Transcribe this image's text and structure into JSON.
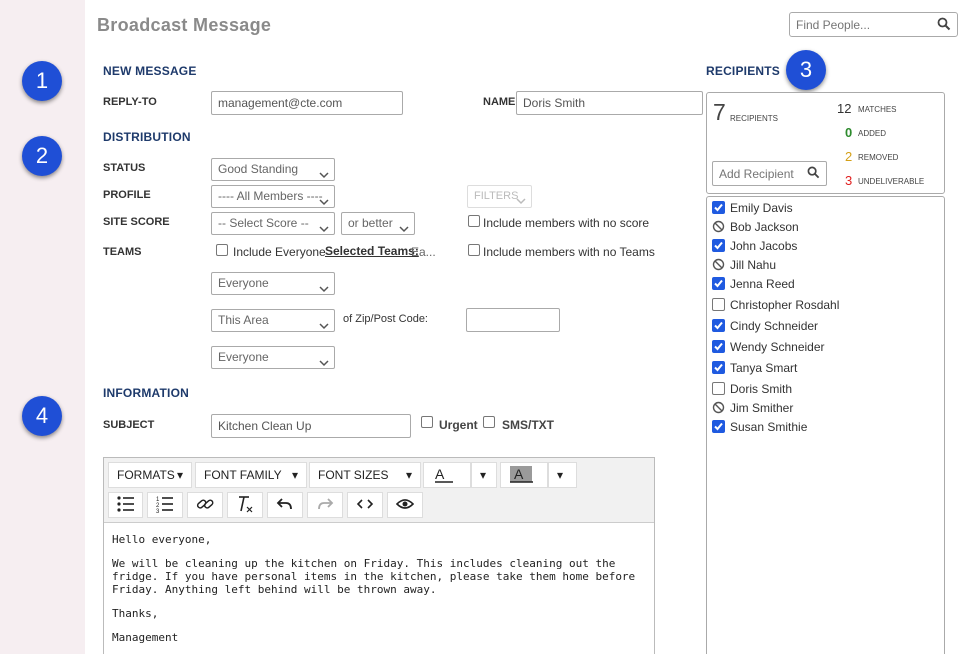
{
  "header": {
    "title": "Broadcast Message",
    "search_placeholder": "Find People..."
  },
  "badges": [
    "1",
    "2",
    "3",
    "4"
  ],
  "new_message": {
    "section": "NEW MESSAGE",
    "reply_to_label": "REPLY-TO",
    "reply_to_value": "management@cte.com",
    "name_label": "NAME",
    "name_value": "Doris Smith"
  },
  "distribution": {
    "section": "DISTRIBUTION",
    "status_label": "STATUS",
    "status_value": "Good Standing",
    "profile_label": "PROFILE",
    "profile_value": "---- All Members ----",
    "filters_label": "FILTERS",
    "site_score_label": "SITE SCORE",
    "site_score_value": "-- Select Score --",
    "or_better_value": "or better",
    "no_score_label": "Include members with no score",
    "teams_label": "TEAMS",
    "include_everyone_label": "Include Everyone",
    "selected_teams_label": "Selected Teams:",
    "selected_teams_value": "Ea...",
    "no_teams_label": "Include members with no Teams",
    "everyone_1": "Everyone",
    "this_area": "This Area",
    "zip_label": "of Zip/Post Code:",
    "zip_value": "",
    "everyone_2": "Everyone"
  },
  "information": {
    "section": "INFORMATION",
    "subject_label": "SUBJECT",
    "subject_value": "Kitchen Clean Up",
    "urgent_label": "Urgent",
    "sms_label": "SMS/TXT"
  },
  "editor": {
    "toolbar": {
      "formats": "FORMATS",
      "font_family": "FONT FAMILY",
      "font_sizes": "FONT SIZES"
    },
    "body": {
      "greeting": "Hello everyone,",
      "paragraph": "We will be cleaning up the kitchen on Friday. This includes cleaning out the fridge. If you have personal items in the kitchen, please take them home before Friday. Anything left behind will be thrown away.",
      "closing": "Thanks,",
      "signature": "Management"
    }
  },
  "recipients": {
    "section": "RECIPIENTS",
    "count": "7",
    "count_label": "RECIPIENTS",
    "add_placeholder": "Add Recipient",
    "stats": [
      {
        "value": "12",
        "label": "MATCHES",
        "color": "#333333"
      },
      {
        "value": "0",
        "label": "ADDED",
        "color": "#2e8b2e"
      },
      {
        "value": "2",
        "label": "REMOVED",
        "color": "#d4a017"
      },
      {
        "value": "3",
        "label": "UNDELIVERABLE",
        "color": "#e02020"
      }
    ],
    "list": [
      {
        "name": "Emily Davis",
        "state": "checked"
      },
      {
        "name": "Bob Jackson",
        "state": "blocked"
      },
      {
        "name": "John Jacobs",
        "state": "checked"
      },
      {
        "name": "Jill Nahu",
        "state": "blocked"
      },
      {
        "name": "Jenna Reed",
        "state": "checked"
      },
      {
        "name": "Christopher Rosdahl",
        "state": "unchecked"
      },
      {
        "name": "Cindy Schneider",
        "state": "checked"
      },
      {
        "name": "Wendy Schneider",
        "state": "checked"
      },
      {
        "name": "Tanya Smart",
        "state": "checked"
      },
      {
        "name": "Doris Smith",
        "state": "unchecked"
      },
      {
        "name": "Jim Smither",
        "state": "blocked"
      },
      {
        "name": "Susan Smithie",
        "state": "checked"
      }
    ]
  }
}
